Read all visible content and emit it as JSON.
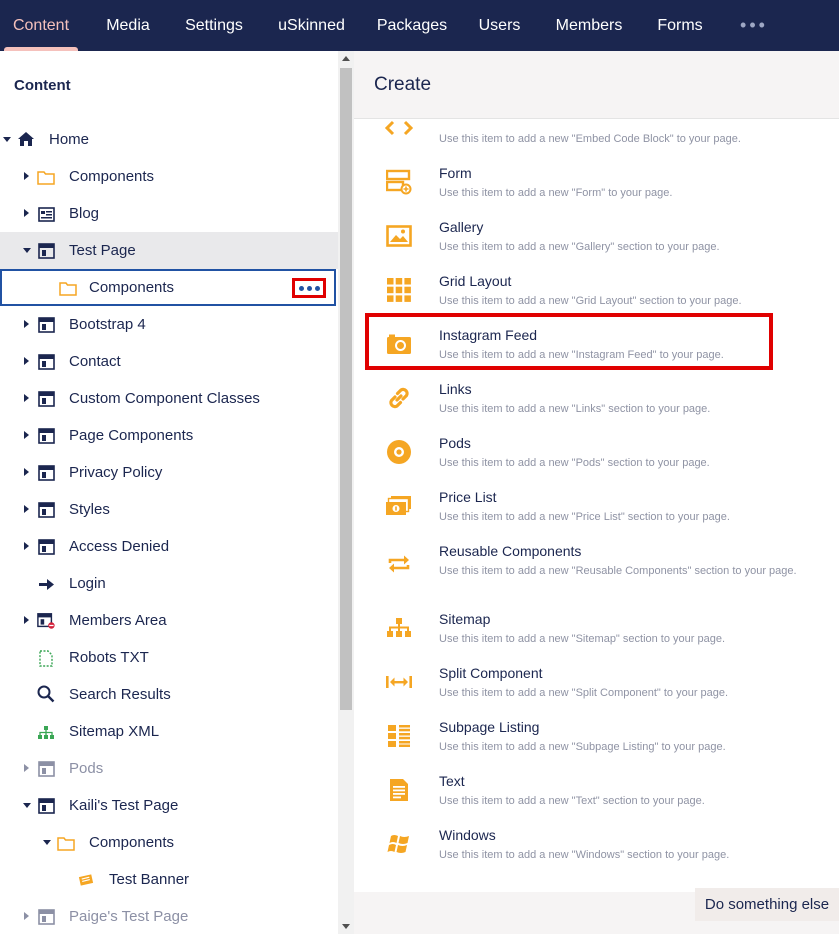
{
  "colors": {
    "nav_bg": "#1b264f",
    "accent": "#f5c1bc",
    "icon_orange": "#f5a623",
    "highlight": "#e00000",
    "link_blue": "#2152a3"
  },
  "topnav": {
    "items": [
      {
        "label": "Content"
      },
      {
        "label": "Media"
      },
      {
        "label": "Settings"
      },
      {
        "label": "uSkinned"
      },
      {
        "label": "Packages"
      },
      {
        "label": "Users"
      },
      {
        "label": "Members"
      },
      {
        "label": "Forms"
      }
    ],
    "more": "•••"
  },
  "sidebar": {
    "title": "Content",
    "tree": [
      {
        "label": "Home",
        "icon": "home-icon"
      },
      {
        "label": "Components",
        "icon": "folder-icon"
      },
      {
        "label": "Blog",
        "icon": "blog-icon"
      },
      {
        "label": "Test Page",
        "icon": "page-icon"
      },
      {
        "label": "Components",
        "icon": "folder-icon"
      },
      {
        "label": "Bootstrap 4",
        "icon": "page-icon"
      },
      {
        "label": "Contact",
        "icon": "page-icon"
      },
      {
        "label": "Custom Component Classes",
        "icon": "page-icon"
      },
      {
        "label": "Page Components",
        "icon": "page-icon"
      },
      {
        "label": "Privacy Policy",
        "icon": "page-icon"
      },
      {
        "label": "Styles",
        "icon": "page-icon"
      },
      {
        "label": "Access Denied",
        "icon": "page-icon"
      },
      {
        "label": "Login",
        "icon": "arrow-right-icon"
      },
      {
        "label": "Members Area",
        "icon": "restricted-page-icon"
      },
      {
        "label": "Robots TXT",
        "icon": "file-icon"
      },
      {
        "label": "Search Results",
        "icon": "search-icon"
      },
      {
        "label": "Sitemap XML",
        "icon": "sitemap-icon"
      },
      {
        "label": "Pods",
        "icon": "page-icon"
      },
      {
        "label": "Kaili's Test Page",
        "icon": "page-icon"
      },
      {
        "label": "Components",
        "icon": "folder-icon"
      },
      {
        "label": "Test Banner",
        "icon": "banner-icon"
      },
      {
        "label": "Paige's Test Page",
        "icon": "page-icon"
      }
    ]
  },
  "panel": {
    "title": "Create",
    "items": [
      {
        "name": "",
        "desc": "Use this item to add a new \"Embed Code Block\" to your page.",
        "icon": "code-icon"
      },
      {
        "name": "Form",
        "desc": "Use this item to add a new \"Form\" to your page.",
        "icon": "form-icon"
      },
      {
        "name": "Gallery",
        "desc": "Use this item to add a new \"Gallery\" section to your page.",
        "icon": "image-icon"
      },
      {
        "name": "Grid Layout",
        "desc": "Use this item to add a new \"Grid Layout\" section to your page.",
        "icon": "grid-icon"
      },
      {
        "name": "Instagram Feed",
        "desc": "Use this item to add a new \"Instagram Feed\" to your page.",
        "icon": "camera-icon"
      },
      {
        "name": "Links",
        "desc": "Use this item to add a new \"Links\" section to your page.",
        "icon": "link-icon"
      },
      {
        "name": "Pods",
        "desc": "Use this item to add a new \"Pods\" section to your page.",
        "icon": "pods-icon"
      },
      {
        "name": "Price List",
        "desc": "Use this item to add a new \"Price List\" section to your page.",
        "icon": "price-icon"
      },
      {
        "name": "Reusable Components",
        "desc": "Use this item to add a new \"Reusable Components\" section to your page.",
        "icon": "repeat-icon"
      },
      {
        "name": "Sitemap",
        "desc": "Use this item to add a new \"Sitemap\" section to your page.",
        "icon": "sitemap-icon"
      },
      {
        "name": "Split Component",
        "desc": "Use this item to add a new \"Split Component\" to your page.",
        "icon": "split-icon"
      },
      {
        "name": "Subpage Listing",
        "desc": "Use this item to add a new \"Subpage Listing\" to your page.",
        "icon": "listing-icon"
      },
      {
        "name": "Text",
        "desc": "Use this item to add a new \"Text\" section to your page.",
        "icon": "text-icon"
      },
      {
        "name": "Windows",
        "desc": "Use this item to add a new \"Windows\" section to your page.",
        "icon": "windows-icon"
      }
    ],
    "footer_button": "Do something else"
  }
}
